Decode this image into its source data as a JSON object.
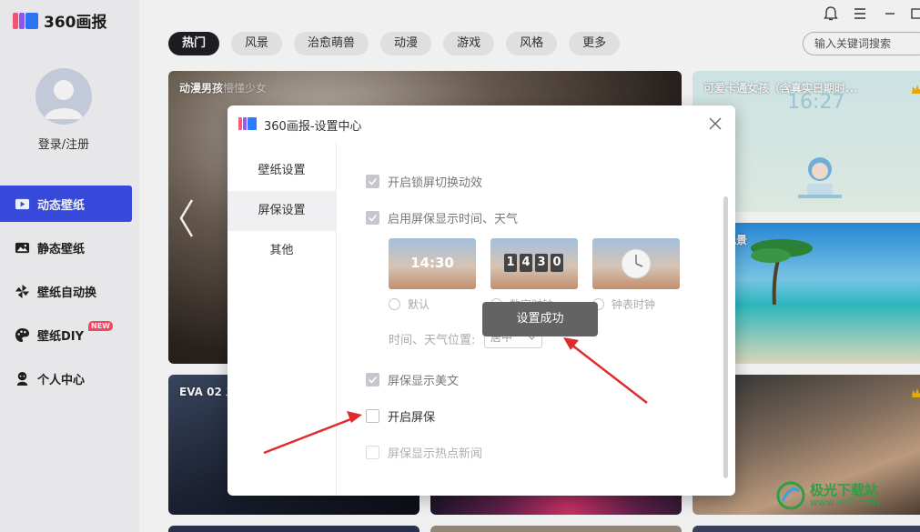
{
  "app": {
    "name": "360画报"
  },
  "sidebar": {
    "login": "登录/注册",
    "items": [
      {
        "label": "动态壁纸",
        "icon": "video-icon",
        "active": true
      },
      {
        "label": "静态壁纸",
        "icon": "image-icon"
      },
      {
        "label": "壁纸自动换",
        "icon": "pinwheel-icon"
      },
      {
        "label": "壁纸DIY",
        "icon": "palette-icon",
        "badge": "NEW"
      },
      {
        "label": "个人中心",
        "icon": "user-icon"
      }
    ]
  },
  "window": {
    "icons": [
      "bell-icon",
      "menu-icon",
      "minimize-icon"
    ]
  },
  "categories": [
    "热门",
    "风景",
    "治愈萌兽",
    "动漫",
    "游戏",
    "风格",
    "更多"
  ],
  "search": {
    "placeholder": "输入关键词搜索"
  },
  "cards": {
    "c1": "动漫男孩",
    "c1b": "懵懂少女",
    "c2": "可爱卡通女孩（含真实日期时...",
    "c2_time": "16:27",
    "c3": "海滩风景",
    "c4": "EVA 02 二"
  },
  "dialog": {
    "title": "360画报-设置中心",
    "nav": [
      "壁纸设置",
      "屏保设置",
      "其他"
    ],
    "active_nav": "屏保设置",
    "options": {
      "lock_anim": {
        "label": "开启锁屏切换动效",
        "checked": true
      },
      "show_time": {
        "label": "启用屏保显示时间、天气",
        "checked": true
      },
      "show_text": {
        "label": "屏保显示美文",
        "checked": true
      },
      "enable_screensaver": {
        "label": "开启屏保",
        "checked": false
      },
      "hot_news": {
        "label": "屏保显示热点新闻",
        "checked": false
      }
    },
    "styles": [
      {
        "label": "默认",
        "preview": "14:30"
      },
      {
        "label": "数字时钟",
        "preview": [
          "1",
          "4",
          "3",
          "0"
        ]
      },
      {
        "label": "钟表时钟"
      }
    ],
    "position_label": "时间、天气位置:",
    "position_value": "居中"
  },
  "toast": "设置成功",
  "colors": {
    "accent": "#3a4ee8",
    "arrow": "#e02b2b",
    "toast_bg": "#636363"
  },
  "watermark": {
    "text": "极光下载站",
    "url": "www.xz7.com"
  }
}
